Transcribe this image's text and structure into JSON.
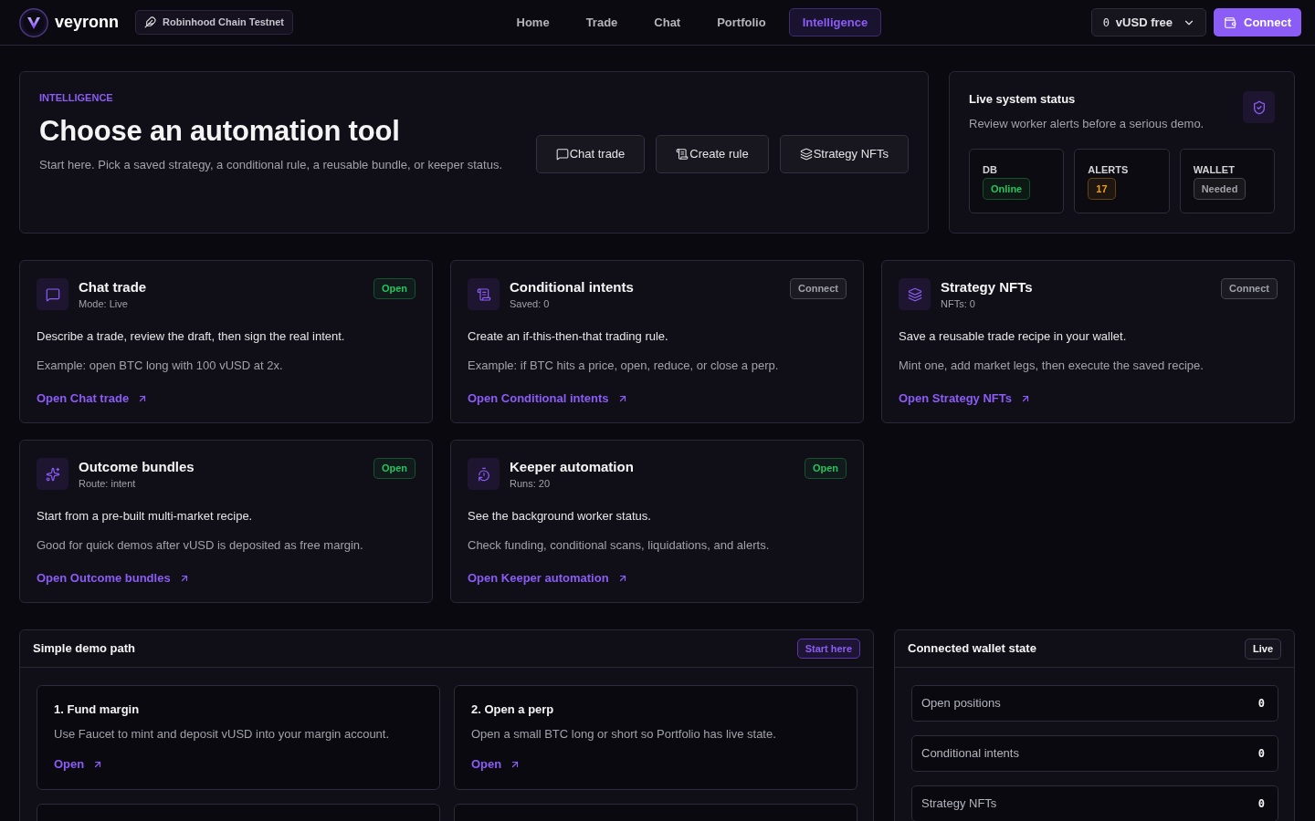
{
  "header": {
    "brand": "veyronn",
    "network": "Robinhood Chain Testnet",
    "nav": [
      {
        "label": "Home",
        "selected": false
      },
      {
        "label": "Trade",
        "selected": false
      },
      {
        "label": "Chat",
        "selected": false
      },
      {
        "label": "Portfolio",
        "selected": false
      },
      {
        "label": "Intelligence",
        "selected": true
      }
    ],
    "balance": {
      "amount": "0",
      "unit": "vUSD free"
    },
    "connect": "Connect"
  },
  "hero": {
    "eyebrow": "INTELLIGENCE",
    "title": "Choose an automation tool",
    "subtitle": "Start here. Pick a saved strategy, a conditional rule, a reusable bundle, or keeper status.",
    "actions": [
      "Chat trade",
      "Create rule",
      "Strategy NFTs"
    ]
  },
  "system_status": {
    "title": "Live system status",
    "subtitle": "Review worker alerts before a serious demo.",
    "stats": [
      {
        "label": "DB",
        "badge": "Online",
        "color": "#22c55e"
      },
      {
        "label": "ALERTS",
        "badge": "17",
        "color": "#f59e0b"
      },
      {
        "label": "WALLET",
        "badge": "Needed",
        "color": "#a1a1aa"
      }
    ]
  },
  "tools": [
    {
      "title": "Chat trade",
      "meta": "Mode: Live",
      "badge": "Open",
      "color": "#22c55e",
      "description": "Describe a trade, review the draft, then sign the real intent.",
      "example": "Example: open BTC long with 100 vUSD at 2x.",
      "link": "Open Chat trade"
    },
    {
      "title": "Conditional intents",
      "meta": "Saved: 0",
      "badge": "Connect",
      "color": "#a1a1aa",
      "description": "Create an if-this-then-that trading rule.",
      "example": "Example: if BTC hits a price, open, reduce, or close a perp.",
      "link": "Open Conditional intents"
    },
    {
      "title": "Strategy NFTs",
      "meta": "NFTs: 0",
      "badge": "Connect",
      "color": "#a1a1aa",
      "description": "Save a reusable trade recipe in your wallet.",
      "example": "Mint one, add market legs, then execute the saved recipe.",
      "link": "Open Strategy NFTs"
    },
    {
      "title": "Outcome bundles",
      "meta": "Route: intent",
      "badge": "Open",
      "color": "#22c55e",
      "description": "Start from a pre-built multi-market recipe.",
      "example": "Good for quick demos after vUSD is deposited as free margin.",
      "link": "Open Outcome bundles"
    },
    {
      "title": "Keeper automation",
      "meta": "Runs: 20",
      "badge": "Open",
      "color": "#22c55e",
      "description": "See the background worker status.",
      "example": "Check funding, conditional scans, liquidations, and alerts.",
      "link": "Open Keeper automation"
    }
  ],
  "demo_path": {
    "title": "Simple demo path",
    "badge": "Start here",
    "steps": [
      {
        "kind": "step",
        "title": "1. Fund margin",
        "text": "Use Faucet to mint and deposit vUSD into your margin account.",
        "link": "Open"
      },
      {
        "kind": "step",
        "title": "2. Open a perp",
        "text": "Open a small BTC long or short so Portfolio has live state.",
        "link": "Open"
      },
      {
        "kind": "cut_off"
      },
      {
        "kind": "cut_off"
      }
    ]
  },
  "wallet_state": {
    "title": "Connected wallet state",
    "badge": "Live",
    "rows": [
      {
        "label": "Open positions",
        "value": "0"
      },
      {
        "label": "Conditional intents",
        "value": "0"
      },
      {
        "label": "Strategy NFTs",
        "value": "0"
      }
    ]
  }
}
